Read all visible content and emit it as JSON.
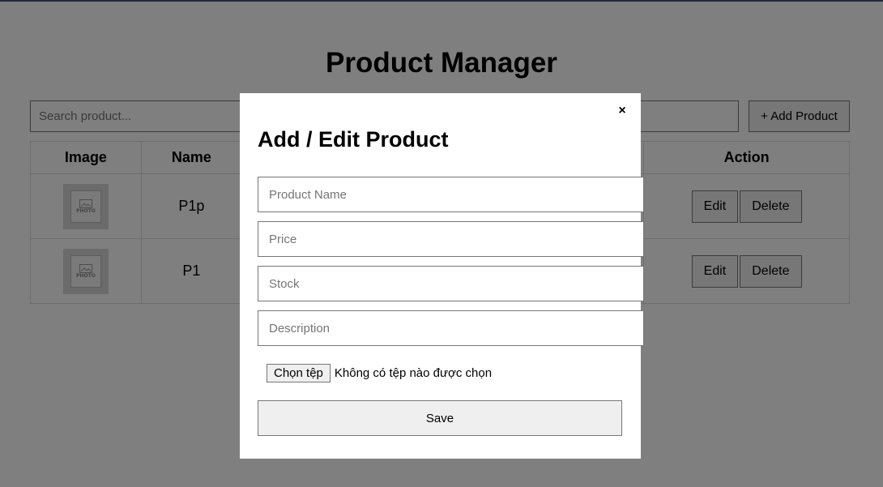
{
  "page": {
    "title": "Product Manager",
    "search_placeholder": "Search product...",
    "add_button_label": "+ Add Product"
  },
  "table": {
    "headers": [
      "Image",
      "Name",
      "Action"
    ],
    "rows": [
      {
        "name": "P1p",
        "image_caption": "PHOTO",
        "edit_label": "Edit",
        "delete_label": "Delete"
      },
      {
        "name": "P1",
        "image_caption": "PHOTO",
        "edit_label": "Edit",
        "delete_label": "Delete"
      }
    ]
  },
  "modal": {
    "close_icon": "×",
    "title": "Add / Edit Product",
    "fields": {
      "name_placeholder": "Product Name",
      "price_placeholder": "Price",
      "stock_placeholder": "Stock",
      "description_placeholder": "Description"
    },
    "file_button_label": "Chọn tệp",
    "file_status": "Không có tệp nào được chọn",
    "save_label": "Save"
  },
  "colors": {
    "overlay": "#000000",
    "button_bg": "#efefef",
    "modal_bg": "#ffffff"
  }
}
